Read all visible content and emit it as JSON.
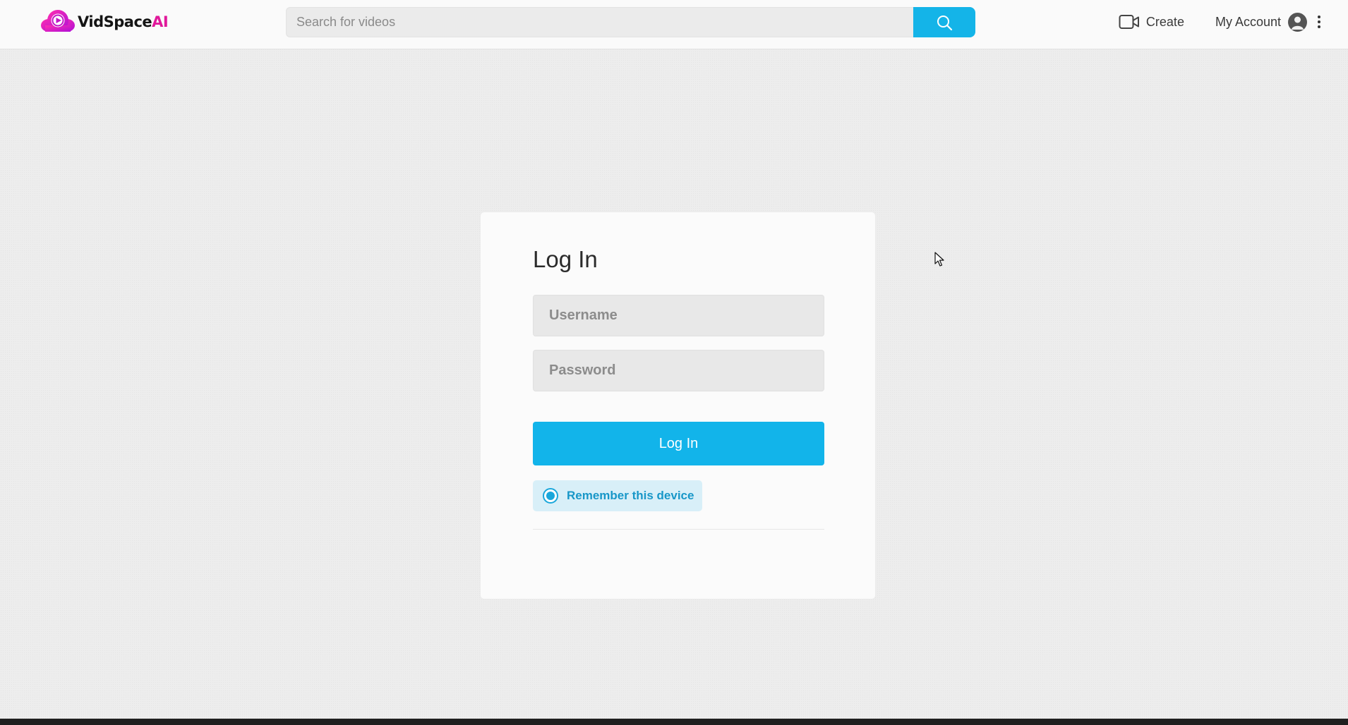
{
  "header": {
    "brand": {
      "name": "VidSpace",
      "suffix": "AI"
    },
    "search": {
      "placeholder": "Search for videos",
      "value": ""
    },
    "nav": {
      "create_label": "Create",
      "account_label": "My Account"
    }
  },
  "login_card": {
    "title": "Log In",
    "username": {
      "placeholder": "Username",
      "value": ""
    },
    "password": {
      "placeholder": "Password",
      "value": ""
    },
    "submit_label": "Log In",
    "remember": {
      "label": "Remember this device",
      "checked": true
    }
  },
  "theme": {
    "accent": "#14b4e8",
    "brand_pink": "#e0189a",
    "remember_bg": "#d8eff8",
    "remember_text": "#1897c8"
  },
  "icons": {
    "logo": "play-cloud-icon",
    "search": "search-icon",
    "create": "video-camera-icon",
    "account": "user-avatar-icon",
    "more": "more-vertical-icon",
    "remember": "radio-selected-icon",
    "cursor": "mouse-pointer-icon"
  }
}
